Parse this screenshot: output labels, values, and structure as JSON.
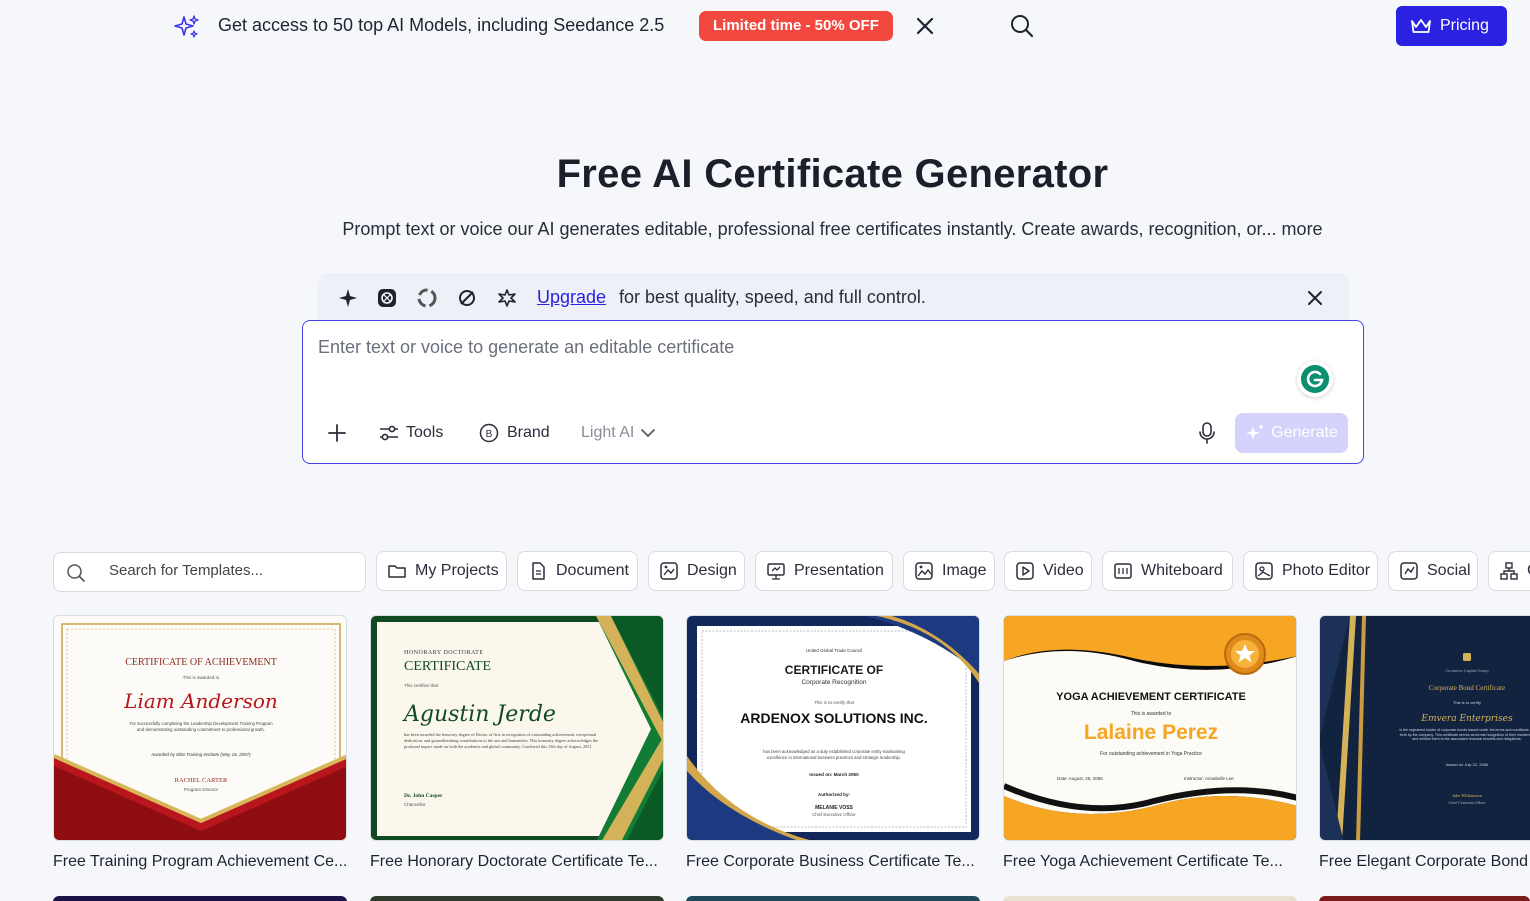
{
  "banner": {
    "text": "Get access to 50 top AI Models, including Seedance 2.5",
    "promo": "Limited time - 50% OFF",
    "pricing_label": "Pricing"
  },
  "hero": {
    "title": "Free AI Certificate Generator",
    "subtitle": "Prompt text or voice our AI generates editable, professional free certificates instantly. Create awards, recognition, or... more"
  },
  "upgrade": {
    "link": "Upgrade",
    "text": "for best quality, speed, and full control."
  },
  "prompt": {
    "placeholder": "Enter text or voice to generate an editable certificate",
    "tools_label": "Tools",
    "brand_label": "Brand",
    "model_label": "Light AI",
    "generate_label": "Generate"
  },
  "filters": {
    "search_placeholder": "Search for Templates...",
    "chips": [
      "My Projects",
      "Document",
      "Design",
      "Presentation",
      "Image",
      "Video",
      "Whiteboard",
      "Photo Editor",
      "Social",
      "C"
    ]
  },
  "cards": [
    {
      "title": "Free Training Program Achievement Ce...",
      "heading": "CERTIFICATE OF ACHIEVEMENT",
      "awarded": "This is awarded to",
      "name": "Liam Anderson",
      "body": "For successfully completing the Leadership Development Training Program and demonstrating outstanding commitment to professional growth.",
      "awardedby": "Awarded by Elite Training Institute (May 18, 2057)",
      "signer": "RACHEL CARTER",
      "role": "Program Director"
    },
    {
      "title": "Free Honorary Doctorate Certificate Te...",
      "heading": "HONORARY DOCTORATE",
      "heading2": "CERTIFICATE",
      "awarded": "This certifies that",
      "name": "Agustin Jerde",
      "body": "has been awarded the honorary degree of Doctor of Arts in recognition of outstanding achievement, exceptional dedication, and groundbreaking contributions to the arts and humanities. This honorary degree acknowledges the profound impact made on both the academic and global community. Conferred this 15th day of August, 2051.",
      "signer": "Dr. John Casper",
      "role": "Chancellor"
    },
    {
      "title": "Free Corporate Business Certificate Te...",
      "org": "United Global Trade Council",
      "heading": "CERTIFICATE OF",
      "heading2": "Corporate Recognition",
      "certify": "This is to certify that",
      "name": "ARDENOX SOLUTIONS INC.",
      "body": "has been acknowledged as a duly established corporate entity maintaining excellence in international business practices and strategic leadership.",
      "issued": "Issued on: March 2050",
      "authorized": "Authorized by:",
      "signer": "MELANIE VOSS",
      "role": "Chief Executive Officer"
    },
    {
      "title": "Free Yoga Achievement Certificate Te...",
      "heading": "YOGA ACHIEVEMENT CERTIFICATE",
      "awarded": "This is awarded to",
      "name": "Lalaine Perez",
      "body": "For outstanding achievement in Yoga Practice",
      "date": "Date: August, 25, 2056",
      "instructor": "Instructor: Annabelle Lee"
    },
    {
      "title": "Free Elegant Corporate Bond",
      "org": "Centurion Capital Group",
      "heading": "Corporate Bond Certificate",
      "certify": "This is to certify",
      "name": "Emvera Enterprises",
      "body": "is the registered holder of corporate bonds issued under the terms and conditions set forth by the company. This certificate serves as formal recognition of their investment and entitles them to the associated financial benefits and obligations.",
      "issued": "Issued on July 22, 2056",
      "signer": "Jake Williamson",
      "role": "Chief Financial Officer"
    }
  ],
  "colors": {
    "accent": "#2a22e0",
    "promo": "#f2483f",
    "generate_disabled": "#d5d2fb"
  }
}
